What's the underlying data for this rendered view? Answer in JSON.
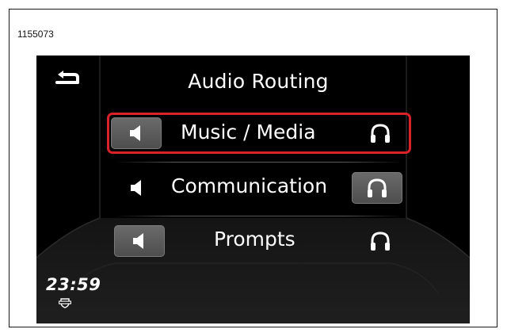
{
  "figure_id": "1155073",
  "screen": {
    "title": "Audio Routing",
    "back_icon": "back-arrow-icon",
    "rows": [
      {
        "label": "Music / Media",
        "selected": true,
        "speaker_active": true,
        "headphones_active": false
      },
      {
        "label": "Communication",
        "selected": false,
        "speaker_active": false,
        "headphones_active": true
      },
      {
        "label": "Prompts",
        "selected": false,
        "speaker_active": true,
        "headphones_active": false
      }
    ],
    "clock": "23:59",
    "logo_icon": "bar-and-shield-logo-icon"
  },
  "colors": {
    "background": "#000000",
    "text": "#ffffff",
    "selection_border": "#d9212a",
    "active_option": "#5c5c5c"
  }
}
